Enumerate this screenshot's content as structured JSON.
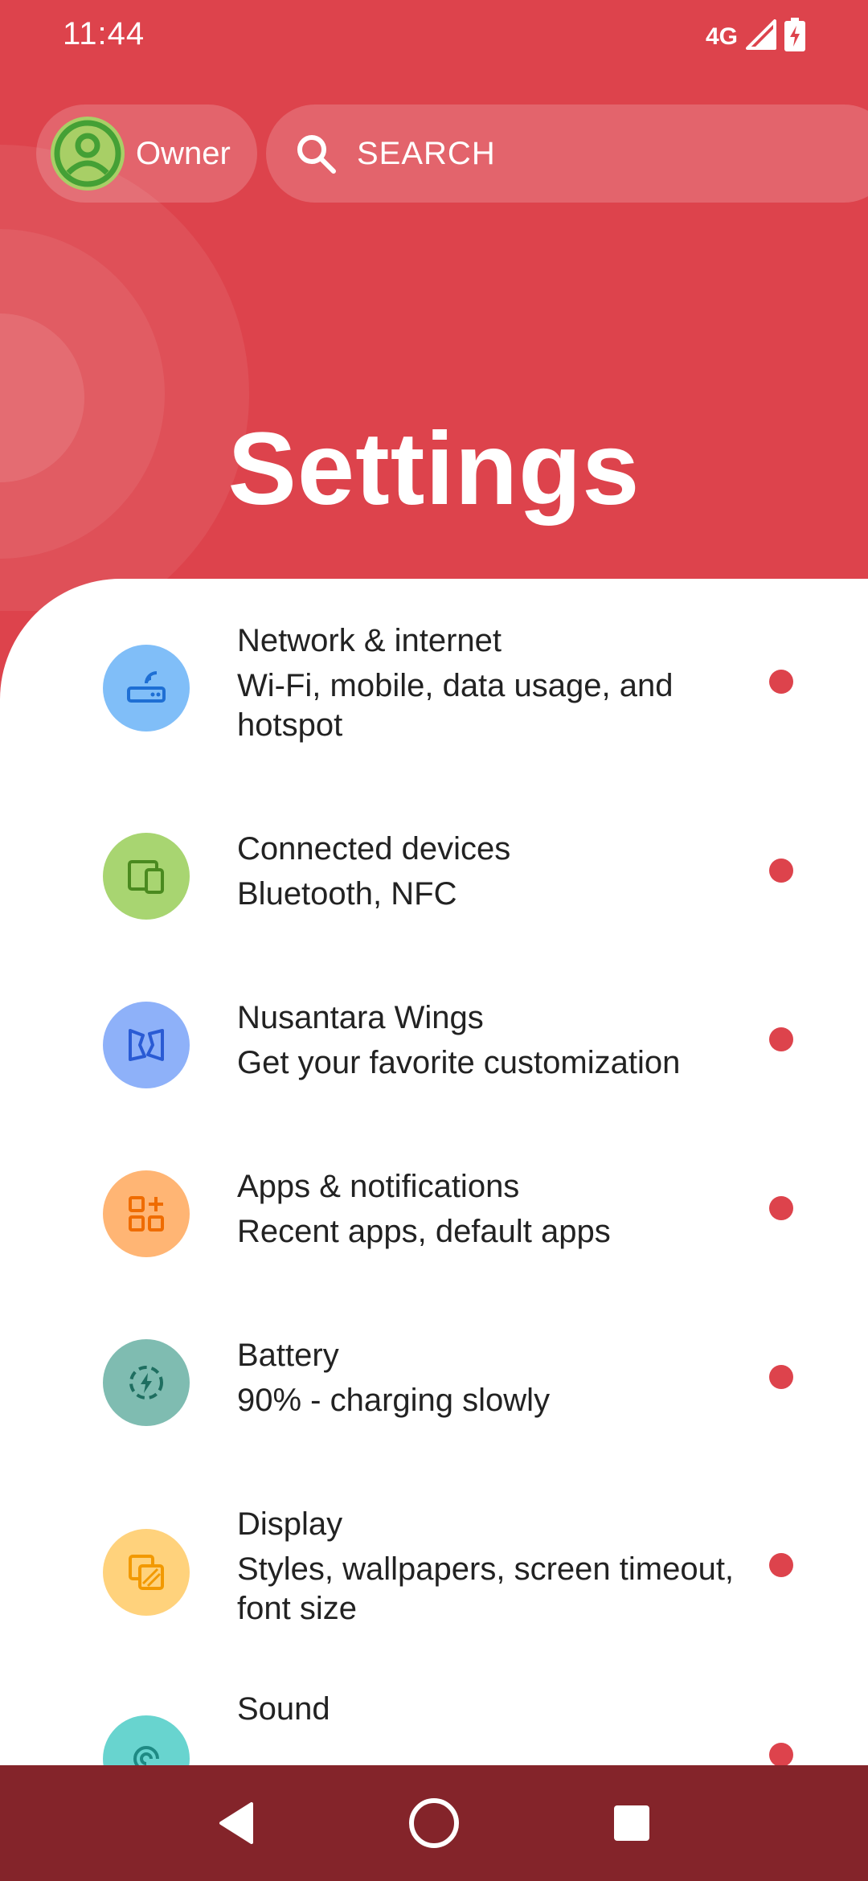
{
  "status_bar": {
    "time": "11:44",
    "network_type": "4G"
  },
  "header": {
    "profile_label": "Owner",
    "search_placeholder": "SEARCH",
    "title": "Settings"
  },
  "settings_items": [
    {
      "title": "Network & internet",
      "subtitle": "Wi-Fi, mobile, data usage, and hotspot",
      "icon": "wifi-router-icon",
      "color": "#80bef8"
    },
    {
      "title": "Connected devices",
      "subtitle": "Bluetooth, NFC",
      "icon": "devices-icon",
      "color": "#a8d571"
    },
    {
      "title": "Nusantara Wings",
      "subtitle": "Get your favorite customization",
      "icon": "wings-icon",
      "color": "#8eb1f9"
    },
    {
      "title": "Apps & notifications",
      "subtitle": "Recent apps, default apps",
      "icon": "apps-icon",
      "color": "#ffb574"
    },
    {
      "title": "Battery",
      "subtitle": "90% - charging slowly",
      "icon": "battery-charging-icon",
      "color": "#7fbcb1"
    },
    {
      "title": "Display",
      "subtitle": "Styles, wallpapers, screen timeout, font size",
      "icon": "display-icon",
      "color": "#ffd27c"
    },
    {
      "title": "Sound",
      "subtitle": "",
      "icon": "sound-icon",
      "color": "#68d4cf"
    }
  ],
  "colors": {
    "accent": "#dd434c",
    "nav_bar": "#84242a"
  }
}
